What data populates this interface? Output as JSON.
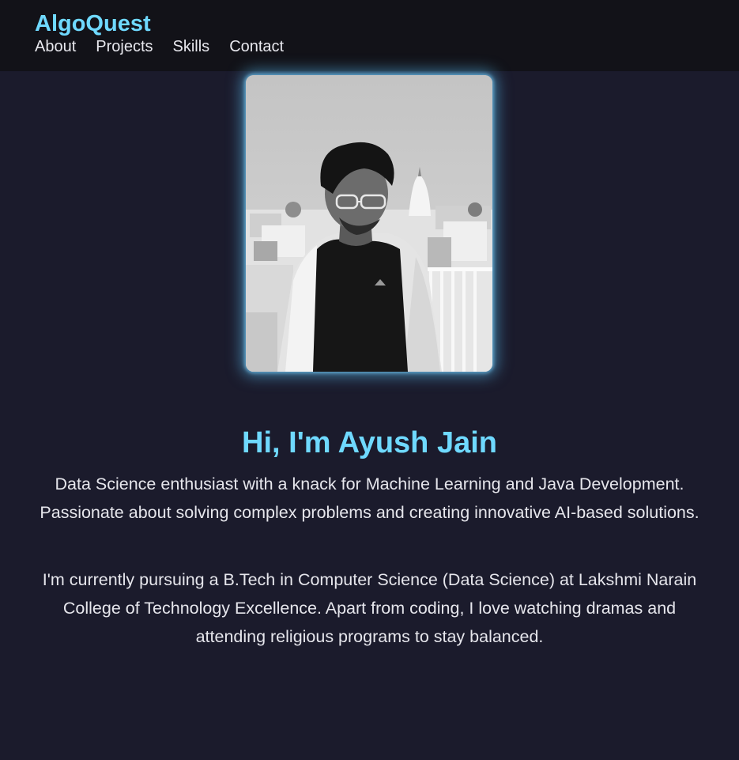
{
  "header": {
    "brand": "AlgoQuest",
    "nav": [
      {
        "label": "About"
      },
      {
        "label": "Projects"
      },
      {
        "label": "Skills"
      },
      {
        "label": "Contact"
      }
    ]
  },
  "profile": {
    "photo_desc_icon": "profile-photo"
  },
  "hero": {
    "title": "Hi, I'm Ayush Jain",
    "intro": "Data Science enthusiast with a knack for Machine Learning and Java Development. Passionate about solving complex problems and creating innovative AI-based solutions.",
    "bio": "I'm currently pursuing a B.Tech in Computer Science (Data Science) at Lakshmi Narain College of Technology Excellence. Apart from coding, I love watching dramas and attending religious programs to stay balanced."
  },
  "colors": {
    "accent": "#6fd9ff",
    "background": "#1b1b2c",
    "header_bg": "#121218",
    "text": "#e6e6ec"
  }
}
